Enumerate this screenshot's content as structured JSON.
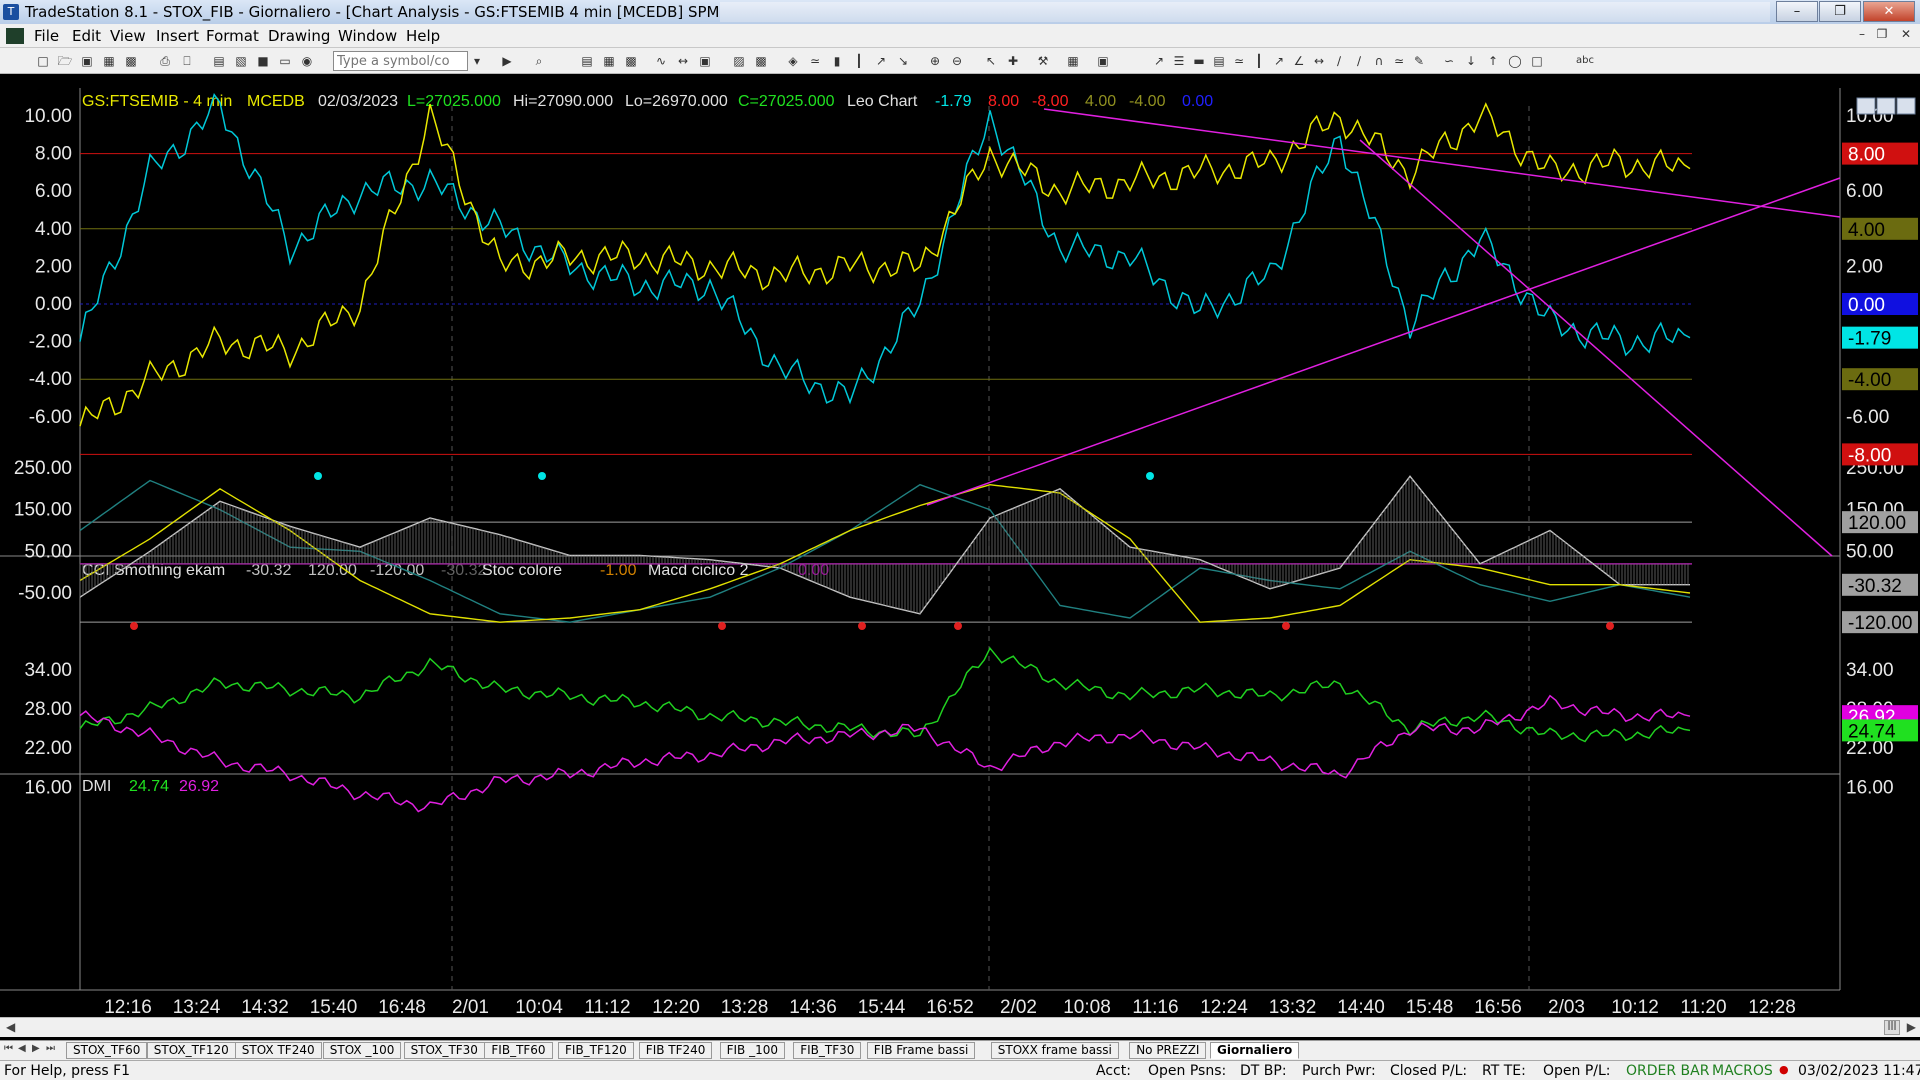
{
  "window": {
    "title": "TradeStation 8.1 - STOX_FIB - Giornaliero - [Chart Analysis - GS:FTSEMIB  4 min  [MCEDB] SPMIB FUTURES]",
    "app_icon": "tradestation-icon"
  },
  "menu": [
    "File",
    "Edit",
    "View",
    "Insert",
    "Format",
    "Drawing",
    "Window",
    "Help"
  ],
  "toolbar": {
    "symbol_placeholder": "Type a symbol/co",
    "text_tool": "abc"
  },
  "price_panel": {
    "header": {
      "symbol": "GS:FTSEMIB - 4 min",
      "exchange": "MCEDB",
      "date": "02/03/2023",
      "last": "L=27025.000",
      "high": "Hi=27090.000",
      "low": "Lo=26970.000",
      "close": "C=27025.000",
      "study": "Leo Chart",
      "values": [
        "-1.79",
        "8.00",
        "-8.00",
        "4.00",
        "-4.00",
        "0.00"
      ],
      "value_colors": [
        "#00e5e5",
        "#ff2020",
        "#ff2020",
        "#909020",
        "#909020",
        "#2020ff"
      ]
    },
    "y_ticks": [
      "10.00",
      "8.00",
      "6.00",
      "4.00",
      "2.00",
      "0.00",
      "-2.00",
      "-4.00",
      "-6.00"
    ],
    "y_tick_values": [
      10,
      8,
      6,
      4,
      2,
      0,
      -2,
      -4,
      -6
    ],
    "right_ticks": [
      "10.00",
      "6.00",
      "2.00",
      "-6.00"
    ],
    "right_tick_values": [
      10,
      6,
      2,
      -6
    ],
    "levels": [
      {
        "value": 8,
        "color": "#d01010",
        "label": "8.00",
        "label_bg": "#d01010",
        "label_fg": "#ffffff"
      },
      {
        "value": 4,
        "color": "#707010",
        "label": "4.00",
        "label_bg": "#6b6b10",
        "label_fg": "#000000"
      },
      {
        "value": 0,
        "color": "#2020c0",
        "label": "0.00",
        "label_bg": "#1010e0",
        "label_fg": "#ffffff"
      },
      {
        "value": -4,
        "color": "#707010",
        "label": "-4.00",
        "label_bg": "#6b6b10",
        "label_fg": "#000000"
      },
      {
        "value": -8,
        "color": "#d01010",
        "label": "-8.00",
        "label_bg": "#d01010",
        "label_fg": "#ffffff"
      }
    ],
    "last_value_label": {
      "value": -1.79,
      "label": "-1.79",
      "bg": "#00e5e5",
      "fg": "#000000"
    }
  },
  "cci_panel": {
    "header": {
      "study": "CCI Smothing ekam",
      "values": [
        "-30.32",
        "120.00",
        "-120.00",
        "-30.32"
      ],
      "value_colors": [
        "#c0c0c0",
        "#c0c0c0",
        "#c0c0c0",
        "#606060"
      ],
      "study2": "Stoc colore",
      "value2": "-1.00",
      "value2_color": "#d08000",
      "study3": "Macd ciclico 2",
      "value3": "0.00",
      "value3_color": "#a000a0"
    },
    "y_ticks": [
      "250.00",
      "150.00",
      "50.00",
      "-50.00"
    ],
    "y_tick_values": [
      250,
      150,
      50,
      -50
    ],
    "right_ticks": [
      "250.00",
      "150.00",
      "50.00"
    ],
    "right_tick_values": [
      250,
      150,
      50
    ],
    "levels": [
      {
        "value": 120,
        "label": "120.00"
      },
      {
        "value": -120,
        "label": "-120.00"
      }
    ],
    "last_value_label": {
      "value": -30.32,
      "label": "-30.32"
    }
  },
  "dmi_panel": {
    "header": {
      "study": "DMI",
      "plus": "24.74",
      "minus": "26.92"
    },
    "y_ticks": [
      "34.00",
      "28.00",
      "22.00",
      "16.00"
    ],
    "y_tick_values": [
      34,
      28,
      22,
      16
    ],
    "right_ticks": [
      "34.00",
      "28.00",
      "22.00",
      "16.00"
    ],
    "right_tick_values": [
      34,
      28,
      22,
      16
    ],
    "labels": [
      {
        "value": 26.92,
        "label": "26.92",
        "bg": "#e000e0",
        "fg": "#ffffff"
      },
      {
        "value": 24.74,
        "label": "24.74",
        "bg": "#20e020",
        "fg": "#000000"
      }
    ]
  },
  "x_axis_labels": [
    "12:16",
    "13:24",
    "14:32",
    "15:40",
    "16:48",
    "2/01",
    "10:04",
    "11:12",
    "12:20",
    "13:28",
    "14:36",
    "15:44",
    "16:52",
    "2/02",
    "10:08",
    "11:16",
    "12:24",
    "13:32",
    "14:40",
    "15:48",
    "16:56",
    "2/03",
    "10:12",
    "11:20",
    "12:28"
  ],
  "tabs": [
    "STOX_TF60",
    "STOX_TF120",
    "STOX TF240",
    "STOX _100",
    "STOX_TF30",
    "FIB_TF60",
    "FIB_TF120",
    "FIB TF240",
    "FIB _100",
    "FIB_TF30",
    "FIB Frame bassi",
    "STOXX frame bassi",
    "No PREZZI",
    "Giornaliero"
  ],
  "active_tab": "Giornaliero",
  "status": {
    "help": "For Help, press F1",
    "acct": "Acct:",
    "open_psns": "Open Psns:",
    "dt_bp": "DT BP:",
    "purch_pwr": "Purch Pwr:",
    "closed_pl": "Closed P/L:",
    "rt_te": "RT TE:",
    "open_pl": "Open P/L:",
    "order_bar": "ORDER BAR",
    "macros": "MACROS",
    "datetime": "03/02/2023 11:47"
  },
  "chart_data": [
    {
      "type": "line",
      "title": "GS:FTSEMIB - 4 min  MCEDB  02/03/2023",
      "x": [
        "12:16",
        "13:24",
        "14:32",
        "15:40",
        "16:48",
        "2/01",
        "10:04",
        "11:12",
        "12:20",
        "13:28",
        "14:36",
        "15:44",
        "16:52",
        "2/02",
        "10:08",
        "11:16",
        "12:24",
        "13:32",
        "14:40",
        "15:48",
        "16:56",
        "2/03",
        "10:12",
        "11:20"
      ],
      "ylim": [
        -7.5,
        11
      ],
      "series": [
        {
          "color": "#00c8d8",
          "values": [
            -2.0,
            7.0,
            10.5,
            3.0,
            6.0,
            6.5,
            4.0,
            2.0,
            1.0,
            1.0,
            -3.5,
            -5.0,
            0.0,
            10.0,
            3.0,
            2.5,
            -0.5,
            1.5,
            9.0,
            -1.0,
            3.5,
            -1.0,
            -2.0,
            -1.79
          ]
        },
        {
          "color": "#e8e800",
          "values": [
            -6.5,
            -4.0,
            -2.0,
            -2.5,
            0.0,
            10.0,
            2.0,
            2.5,
            2.5,
            2.0,
            1.5,
            2.0,
            2.0,
            8.0,
            6.0,
            6.5,
            7.0,
            7.5,
            10.0,
            7.0,
            10.0,
            7.0,
            7.5,
            7.2
          ]
        }
      ]
    },
    {
      "type": "line",
      "title": "CCI Smothing ekam",
      "x": [
        "12:16",
        "13:24",
        "14:32",
        "15:40",
        "16:48",
        "2/01",
        "10:04",
        "11:12",
        "12:20",
        "13:28",
        "14:36",
        "15:44",
        "16:52",
        "2/02",
        "10:08",
        "11:16",
        "12:24",
        "13:32",
        "14:40",
        "15:48",
        "16:56",
        "2/03",
        "10:12",
        "11:20"
      ],
      "ylim": [
        -130,
        265
      ],
      "series": [
        {
          "color": "#c8c8c8",
          "values": [
            -60,
            50,
            170,
            110,
            60,
            130,
            90,
            40,
            40,
            30,
            10,
            -60,
            -100,
            130,
            200,
            60,
            30,
            -40,
            10,
            230,
            20,
            100,
            -30,
            -30
          ]
        },
        {
          "color": "#208080",
          "values": [
            100,
            220,
            150,
            60,
            50,
            -20,
            -100,
            -120,
            -90,
            -60,
            10,
            100,
            210,
            150,
            -80,
            -110,
            10,
            -20,
            -40,
            50,
            -30,
            -70,
            -30,
            -60
          ]
        },
        {
          "color": "#e0e000",
          "values": [
            -20,
            80,
            200,
            100,
            -20,
            -100,
            -120,
            -110,
            -90,
            -40,
            20,
            100,
            160,
            210,
            190,
            80,
            -120,
            -110,
            -80,
            30,
            10,
            -30,
            -30,
            -50
          ]
        }
      ]
    },
    {
      "type": "line",
      "title": "DMI",
      "x": [
        "12:16",
        "13:24",
        "14:32",
        "15:40",
        "16:48",
        "2/01",
        "10:04",
        "11:12",
        "12:20",
        "13:28",
        "14:36",
        "15:44",
        "16:52",
        "2/02",
        "10:08",
        "11:16",
        "12:24",
        "13:32",
        "14:40",
        "15:48",
        "16:56",
        "2/03",
        "10:12",
        "11:20"
      ],
      "ylim": [
        13,
        38
      ],
      "series": [
        {
          "color": "#20d020",
          "values": [
            25,
            28,
            32,
            31,
            30,
            35,
            31,
            30,
            29,
            27,
            26,
            25,
            24,
            37,
            32,
            30,
            31,
            30,
            32,
            25,
            27,
            24,
            24,
            24.74
          ]
        },
        {
          "color": "#e020e0",
          "values": [
            27,
            24,
            20,
            18,
            15,
            13,
            17,
            18,
            20,
            21,
            23,
            24,
            25,
            19,
            23,
            24,
            22,
            20,
            18,
            25,
            25,
            29,
            27,
            26.92
          ]
        }
      ]
    }
  ]
}
